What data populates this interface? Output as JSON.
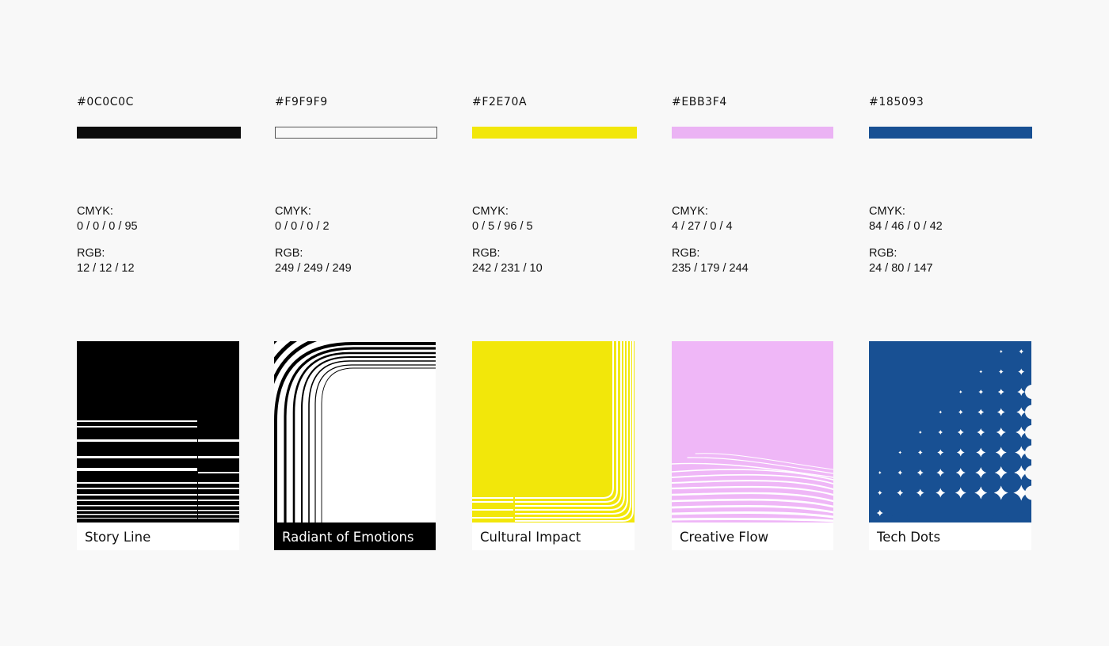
{
  "swatches": [
    {
      "hex": "#0C0C0C",
      "color": "#0c0c0c",
      "cmyk_label": "CMYK:",
      "cmyk": "0 / 0 / 0 / 95",
      "rgb_label": "RGB:",
      "rgb": "12 / 12 / 12",
      "card_title": "Story Line"
    },
    {
      "hex": "#F9F9F9",
      "color": "#f9f9f9",
      "cmyk_label": "CMYK:",
      "cmyk": "0 / 0 / 0 / 2",
      "rgb_label": "RGB:",
      "rgb": "249 / 249 / 249",
      "card_title": "Radiant of Emotions"
    },
    {
      "hex": "#F2E70A",
      "color": "#f2e70a",
      "cmyk_label": "CMYK:",
      "cmyk": "0 / 5 / 96 / 5",
      "rgb_label": "RGB:",
      "rgb": "242 / 231 / 10",
      "card_title": "Cultural Impact"
    },
    {
      "hex": "#EBB3F4",
      "color": "#ebb3f4",
      "cmyk_label": "CMYK:",
      "cmyk": "4 / 27 / 0 / 4",
      "rgb_label": "RGB:",
      "rgb": "235 / 179 / 244",
      "card_title": "Creative Flow"
    },
    {
      "hex": "#185093",
      "color": "#185093",
      "cmyk_label": "CMYK:",
      "cmyk": "84 / 46 / 0 / 42",
      "rgb_label": "RGB:",
      "rgb": "24 / 80 / 147",
      "card_title": "Tech Dots"
    }
  ]
}
